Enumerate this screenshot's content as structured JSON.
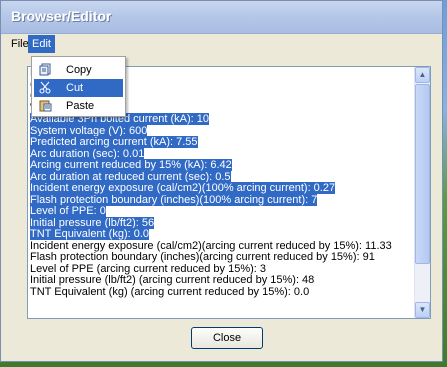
{
  "window": {
    "title": "Browser/Editor"
  },
  "menubar": {
    "file_label": "File",
    "edit_label": "Edit"
  },
  "edit_menu": {
    "items": [
      {
        "label": "Copy",
        "icon": "copy-icon"
      },
      {
        "label": "Cut",
        "icon": "cut-icon"
      },
      {
        "label": "Paste",
        "icon": "paste-icon"
      }
    ],
    "highlighted": "Cut"
  },
  "content": {
    "lines": [
      {
        "text": "Equ                chgear",
        "selected": false
      },
      {
        "text": "Gap                tors (mm): 32",
        "selected": false
      },
      {
        "text": "Gro                ded",
        "selected": false
      },
      {
        "text": "Wor                   ): 500",
        "selected": false
      },
      {
        "text": "Available 3Ph bolted current (kA): 10",
        "selected": true
      },
      {
        "text": "System voltage (V): 600",
        "selected": true
      },
      {
        "text": "Predicted arcing current (kA): 7.55",
        "selected": true
      },
      {
        "text": "Arc duration (sec): 0.01",
        "selected": true
      },
      {
        "text": "Arcing current reduced by 15% (kA): 6.42",
        "selected": true
      },
      {
        "text": "Arc duration at reduced current (sec): 0.5",
        "selected": true
      },
      {
        "text": "Incident energy exposure (cal/cm2)(100% arcing current): 0.27",
        "selected": true
      },
      {
        "text": "Flash protection boundary (inches)(100% arcing current): 7",
        "selected": true
      },
      {
        "text": "Level of PPE: 0",
        "selected": true
      },
      {
        "text": "Initial pressure (lb/ft2): 56",
        "selected": true
      },
      {
        "text": "TNT Equivalent (kg): 0.0",
        "selected": true
      },
      {
        "text": "Incident energy exposure (cal/cm2)(arcing current reduced by 15%): 11.33",
        "selected": false
      },
      {
        "text": "Flash protection boundary (inches)(arcing current reduced by 15%): 91",
        "selected": false
      },
      {
        "text": "Level of PPE (arcing current reduced by 15%): 3",
        "selected": false
      },
      {
        "text": "Initial pressure (lb/ft2) (arcing current reduced by 15%):  48",
        "selected": false
      },
      {
        "text": "TNT Equivalent (kg) (arcing current reduced by 15%): 0.0",
        "selected": false
      }
    ]
  },
  "buttons": {
    "close_label": "Close"
  },
  "colors": {
    "selection": "#316ac5",
    "titlebar": "#b6c8e8",
    "window_face": "#ece9d8"
  }
}
